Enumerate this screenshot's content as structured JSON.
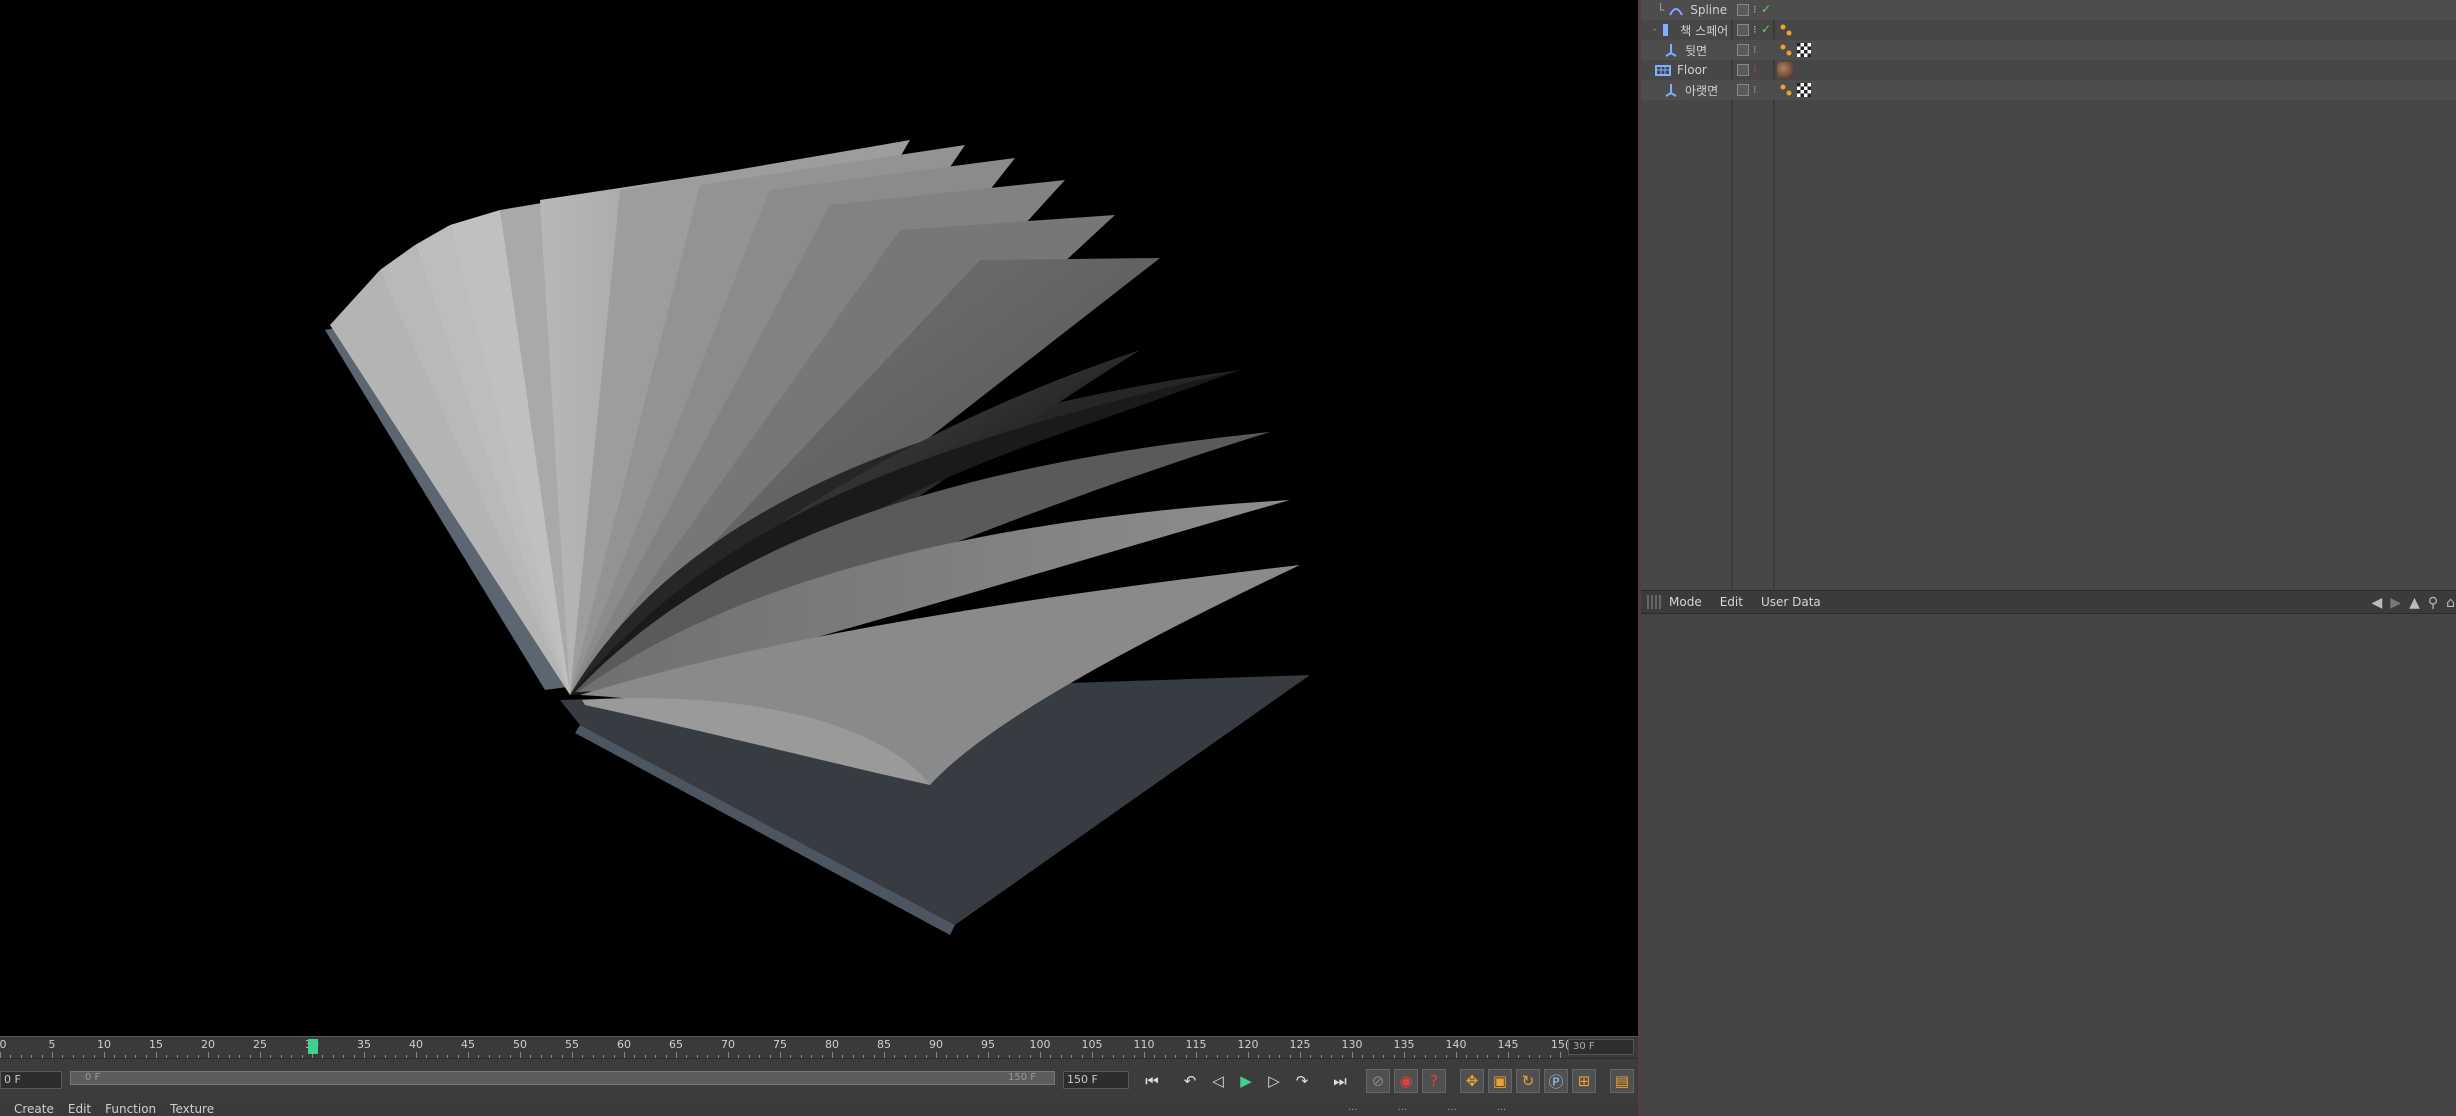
{
  "object_manager": {
    "rows": [
      {
        "name": "Spline W",
        "icon": "spline-wrap-icon",
        "indent": 2
      },
      {
        "name": "책 스페어",
        "icon": "spare-object-icon",
        "indent": 1
      },
      {
        "name": "뒷면",
        "icon": "null-object-icon",
        "indent": 1
      },
      {
        "name": "Floor",
        "icon": "floor-icon",
        "indent": 0
      },
      {
        "name": "아랫면",
        "icon": "null-object-icon",
        "indent": 1
      }
    ]
  },
  "attributes": {
    "menu": [
      "Mode",
      "Edit",
      "User Data"
    ]
  },
  "timeline": {
    "ticks": [
      "0",
      "5",
      "10",
      "15",
      "20",
      "25",
      "30",
      "35",
      "40",
      "45",
      "50",
      "55",
      "60",
      "65",
      "70",
      "75",
      "80",
      "85",
      "90",
      "95",
      "100",
      "105",
      "110",
      "115",
      "120",
      "125",
      "130",
      "135",
      "140",
      "145",
      "15("
    ],
    "current_frame": 30,
    "end_frame_box": "30 F"
  },
  "transport": {
    "start_field": "0 F",
    "range_start": "0 F",
    "range_end": "150 F",
    "end_field": "150 F"
  },
  "material_bar": {
    "menu": [
      "Create",
      "Edit",
      "Function",
      "Texture"
    ],
    "right_items": [
      "...",
      "...",
      "...",
      "..."
    ]
  },
  "colors": {
    "viewport_bg": "#000000",
    "panel_bg": "#474747",
    "accent_play": "#3fd08f",
    "record_red": "#c03030"
  }
}
